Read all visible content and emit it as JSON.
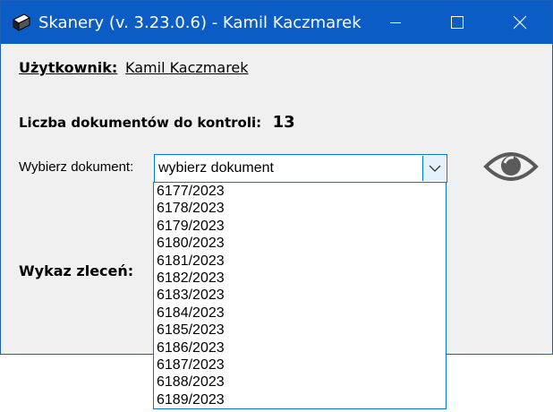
{
  "window": {
    "title": "Skanery (v. 3.23.0.6) - Kamil Kaczmarek",
    "titlebar_color": "#0b5cc4",
    "icons": [
      "scanner-app-icon",
      "minimize-icon",
      "maximize-icon",
      "close-icon"
    ]
  },
  "user": {
    "label": "Użytkownik:",
    "name": "Kamil Kaczmarek"
  },
  "documents": {
    "count_label": "Liczba dokumentów do kontroli:",
    "count_value": "13"
  },
  "document_select": {
    "label": "Wybierz dokument:",
    "value": "wybierz dokument",
    "accent_color": "#0078d7",
    "options": [
      "6177/2023",
      "6178/2023",
      "6179/2023",
      "6180/2023",
      "6181/2023",
      "6182/2023",
      "6183/2023",
      "6184/2023",
      "6185/2023",
      "6186/2023",
      "6187/2023",
      "6188/2023",
      "6189/2023"
    ]
  },
  "preview": {
    "icon": "eye-icon"
  },
  "orders": {
    "label": "Wykaz zleceń:"
  }
}
